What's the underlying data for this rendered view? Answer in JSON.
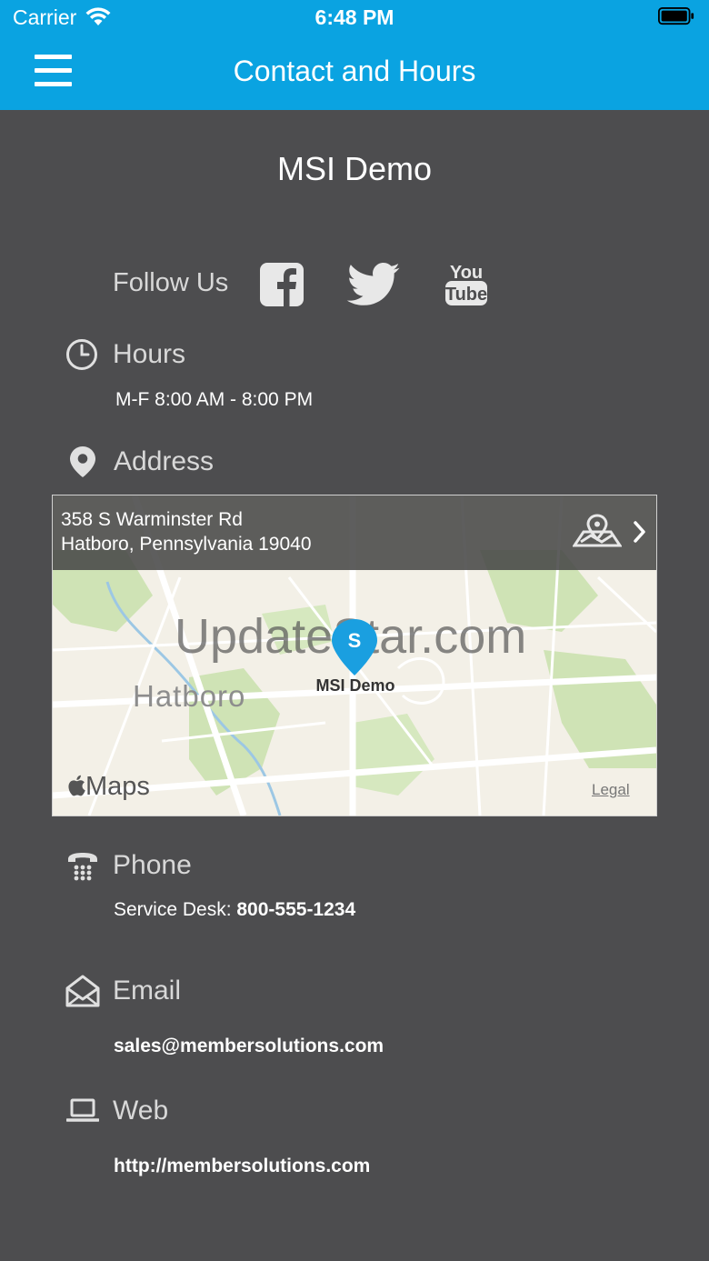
{
  "status": {
    "carrier": "Carrier",
    "time": "6:48 PM"
  },
  "header": {
    "title": "Contact and Hours"
  },
  "org": {
    "name": "MSI Demo"
  },
  "follow": {
    "label": "Follow Us",
    "youtube_top": "You",
    "youtube_bottom": "Tube"
  },
  "hours": {
    "label": "Hours",
    "value": "M-F  8:00 AM - 8:00 PM"
  },
  "address": {
    "label": "Address",
    "line1": "358 S Warminster Rd",
    "line2": "Hatboro, Pennsylvania 19040"
  },
  "map": {
    "watermark": "UpdateStar.com",
    "town": "Hatboro",
    "pin_label": "MSI Demo",
    "pin_letter": "S",
    "brand": "Maps",
    "legal": "Legal"
  },
  "phone": {
    "label": "Phone",
    "prefix": "Service Desk: ",
    "number": "800-555-1234"
  },
  "email": {
    "label": "Email",
    "value": "sales@membersolutions.com"
  },
  "web": {
    "label": "Web",
    "value": "http://membersolutions.com"
  },
  "colors": {
    "header": "#0aa3e1",
    "background": "#4d4d4f",
    "pin": "#1a9fe0"
  }
}
